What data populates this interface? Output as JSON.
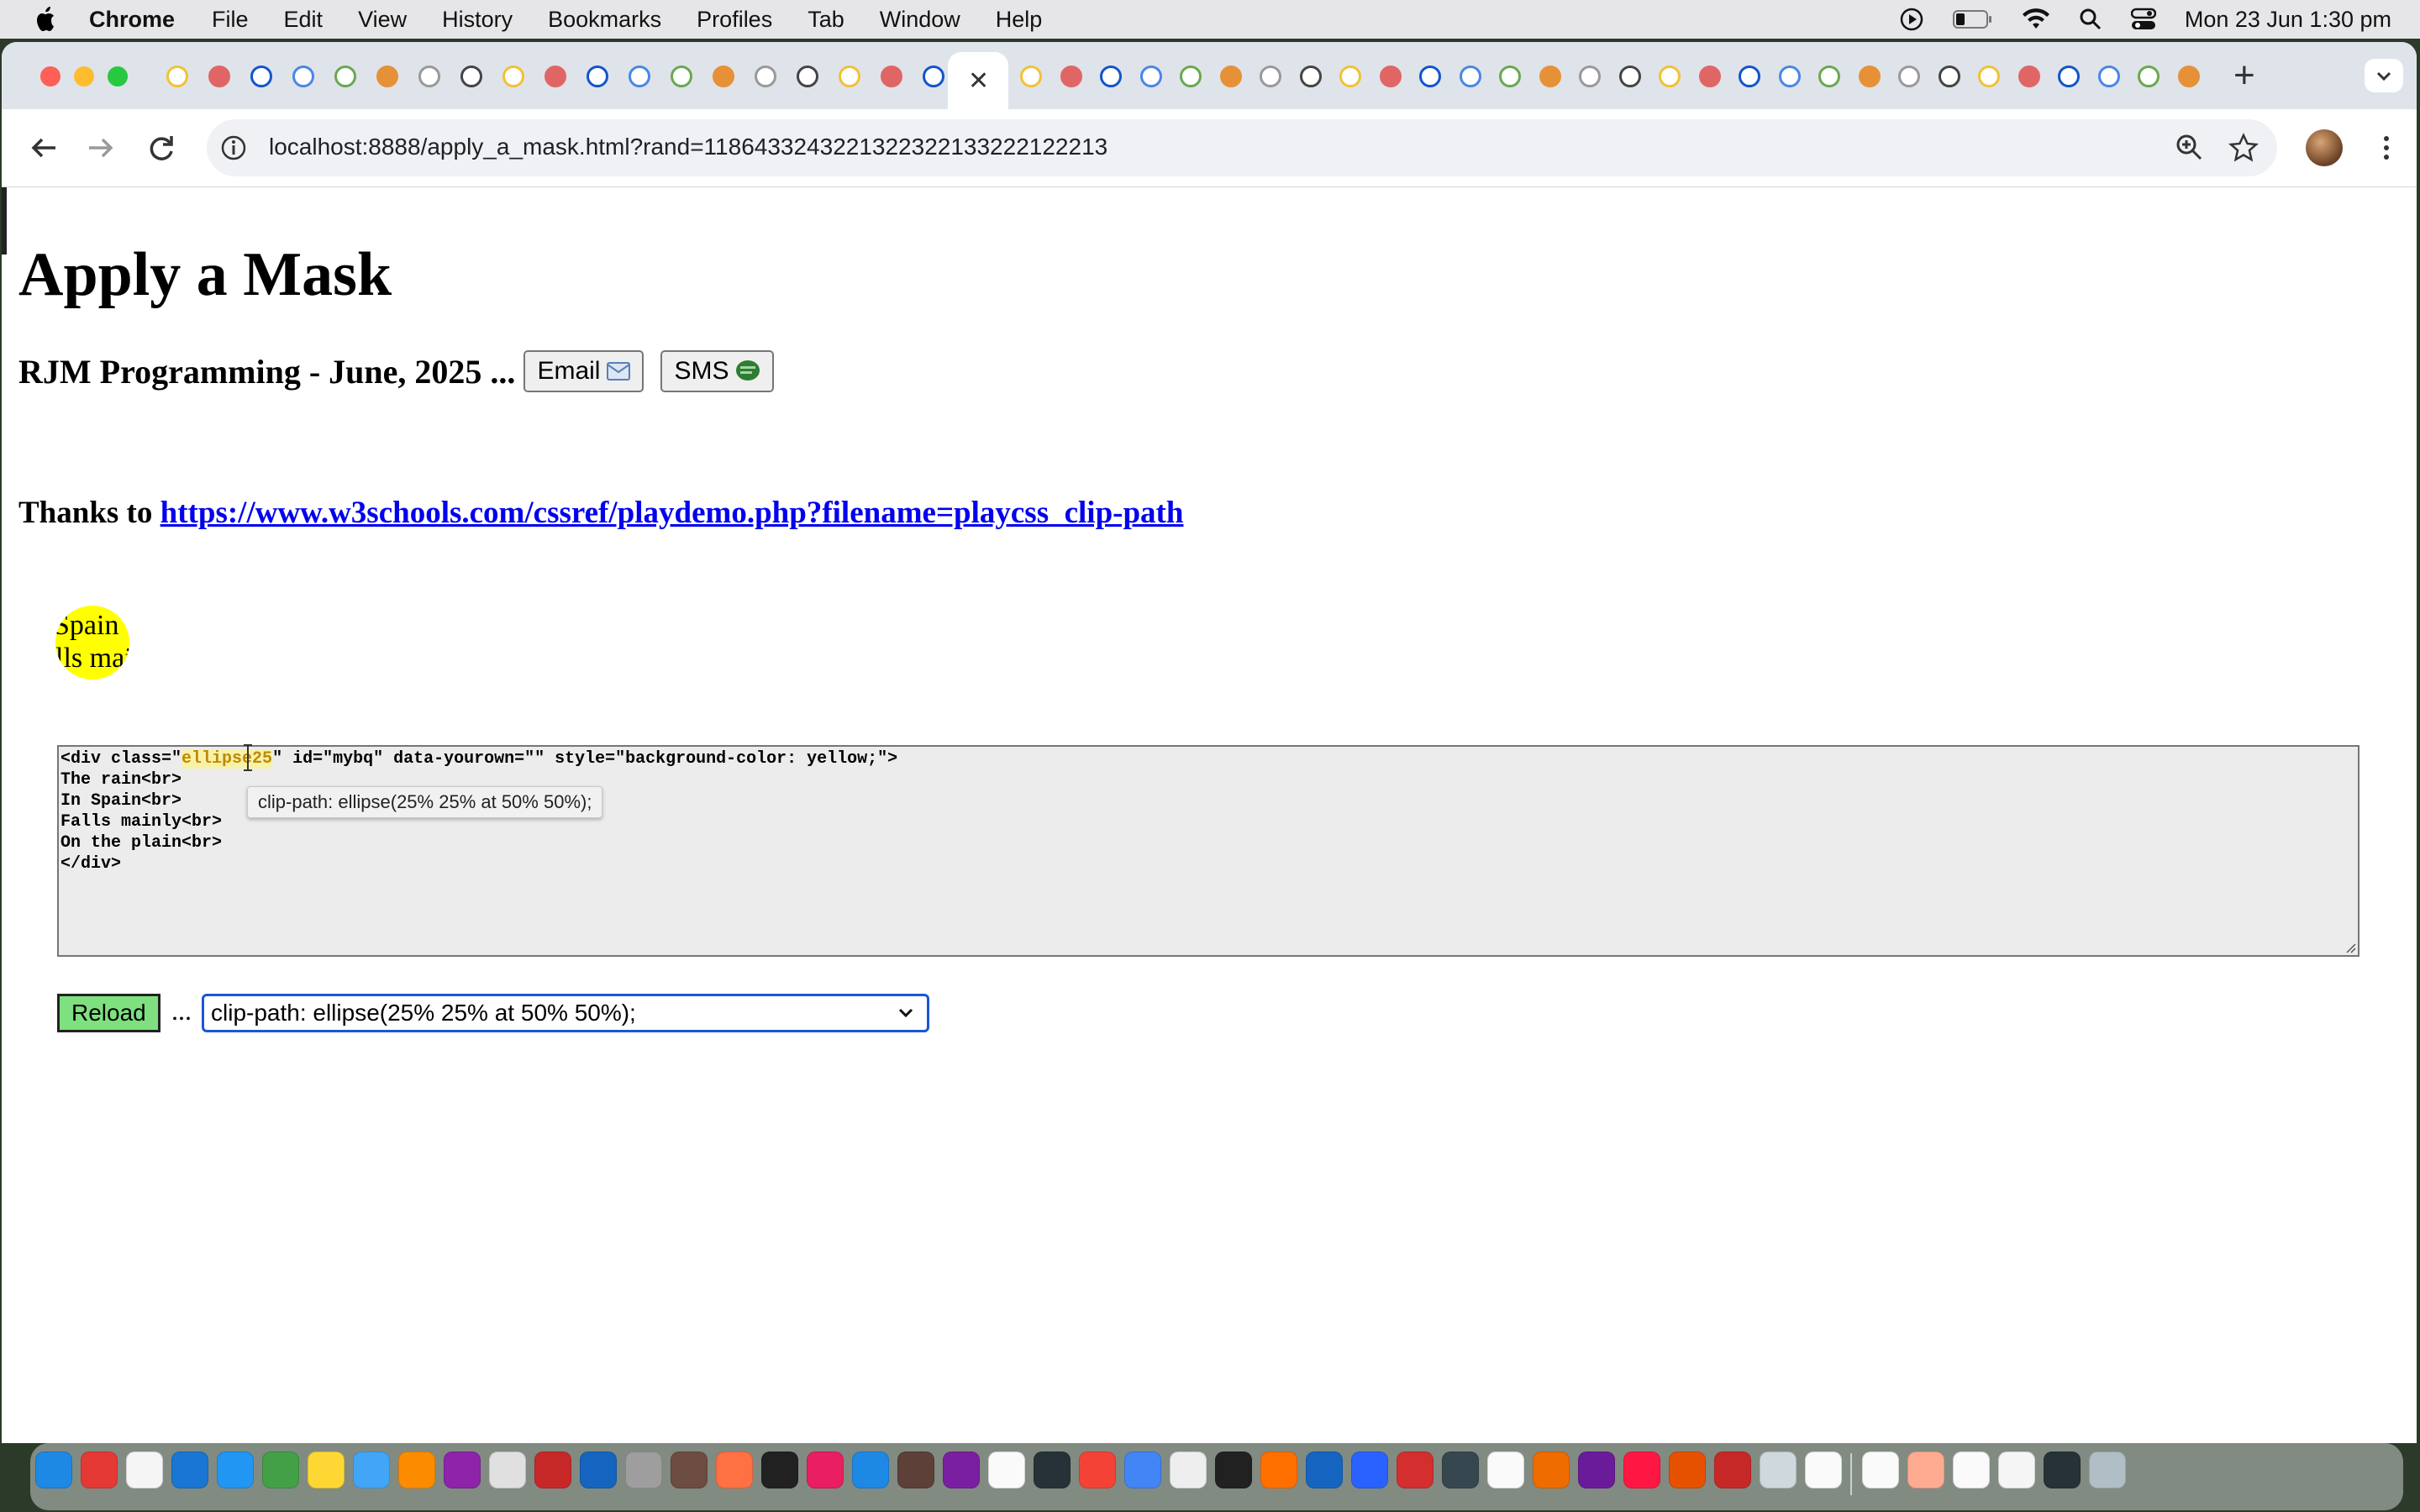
{
  "menubar": {
    "app_name": "Chrome",
    "menus": [
      "File",
      "Edit",
      "View",
      "History",
      "Bookmarks",
      "Profiles",
      "Tab",
      "Window",
      "Help"
    ],
    "clock": "Mon 23 Jun  1:30 pm"
  },
  "browser": {
    "url": "localhost:8888/apply_a_mask.html?rand=1186433243221322322133222122213",
    "tab_count_left": 19,
    "tab_count_right": 30
  },
  "page": {
    "title": "Apply a Mask",
    "subtitle": "RJM Programming - June, 2025 ...",
    "email_label": "Email",
    "sms_label": "SMS",
    "thanks_prefix": "Thanks to",
    "thanks_link": "https://www.w3schools.com/cssref/playdemo.php?filename=playcss_clip-path",
    "demo_lines": [
      "Spain",
      "Falls mai"
    ],
    "code_lines": [
      "<div class=\"ellipse25\" id=\"mybq\" data-yourown=\"\" style=\"background-color: yellow;\">",
      "The rain<br>",
      "In Spain<br>",
      "Falls mainly<br>",
      "On the plain<br>",
      "</div>"
    ],
    "code_line1_before": "<div class=\"",
    "code_line1_highlight": "ellipse25",
    "code_line1_after": "\" id=\"mybq\" data-yourown=\"\" style=\"background-color: yellow;\">",
    "tooltip": "clip-path: ellipse(25% 25% at 50% 50%);",
    "reload_label": "Reload",
    "ellipsis": "...",
    "select_value": "clip-path: ellipse(25% 25% at 50% 50%);"
  },
  "colors": {
    "demo_bg": "#ffff00",
    "reload_bg": "#7fe07f",
    "select_border": "#1a56d8",
    "link": "#0000ee"
  }
}
